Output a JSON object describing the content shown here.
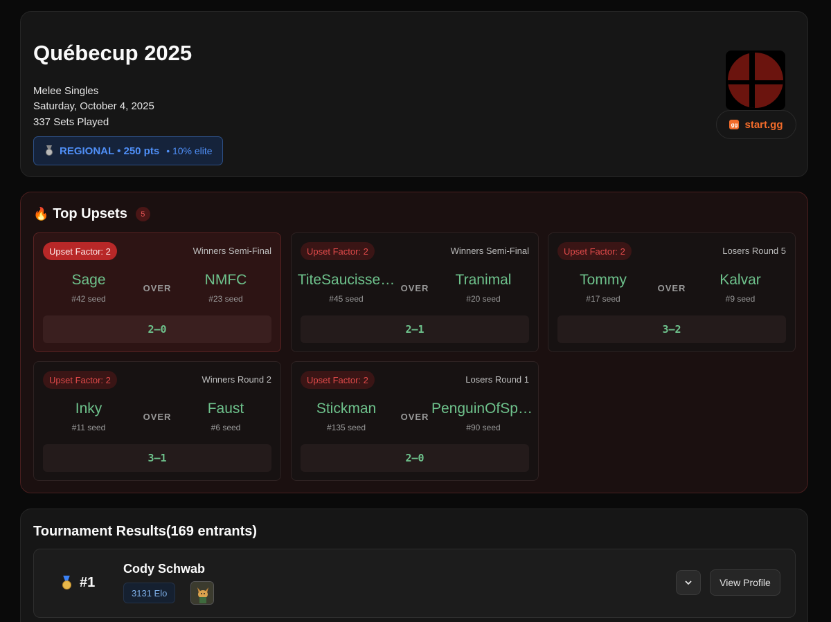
{
  "tournament": {
    "title": "Québecup 2025",
    "event": "Melee Singles",
    "date": "Saturday, October 4, 2025",
    "sets": "337 Sets Played",
    "tier_label": "REGIONAL • 250 pts",
    "tier_elite": "• 10% elite",
    "tier_icon": "medal-icon",
    "startgg_label": "start.gg",
    "startgg_icon": "gg",
    "logo": "smash-logo"
  },
  "upsets": {
    "title": "Top Upsets",
    "count": "5",
    "over_label": "OVER",
    "items": [
      {
        "factor": "Upset Factor: 2",
        "round": "Winners Semi-Final",
        "winner": "Sage",
        "winner_seed": "#42 seed",
        "loser": "NMFC",
        "loser_seed": "#23 seed",
        "score": "2–0"
      },
      {
        "factor": "Upset Factor: 2",
        "round": "Winners Semi-Final",
        "winner": "TiteSaucisse…",
        "winner_seed": "#45 seed",
        "loser": "Tranimal",
        "loser_seed": "#20 seed",
        "score": "2–1"
      },
      {
        "factor": "Upset Factor: 2",
        "round": "Losers Round 5",
        "winner": "Tommy",
        "winner_seed": "#17 seed",
        "loser": "Kalvar",
        "loser_seed": "#9 seed",
        "score": "3–2"
      },
      {
        "factor": "Upset Factor: 2",
        "round": "Winners Round 2",
        "winner": "Inky",
        "winner_seed": "#11 seed",
        "loser": "Faust",
        "loser_seed": "#6 seed",
        "score": "3–1"
      },
      {
        "factor": "Upset Factor: 2",
        "round": "Losers Round 1",
        "winner": "Stickman",
        "winner_seed": "#135 seed",
        "loser": "PenguinOfSpa…",
        "loser_seed": "#90 seed",
        "score": "2–0"
      }
    ]
  },
  "results": {
    "title": "Tournament Results(169 entrants)",
    "rows": [
      {
        "place": "#1",
        "name": "Cody Schwab",
        "elo": "3131 Elo",
        "character_icon": "fox-icon",
        "view_label": "View Profile"
      }
    ]
  },
  "colors": {
    "accent_blue": "#4f8ff7",
    "upset_red": "#e04a4a",
    "win_green": "#6ec28c",
    "startgg_orange": "#f26b2a"
  }
}
